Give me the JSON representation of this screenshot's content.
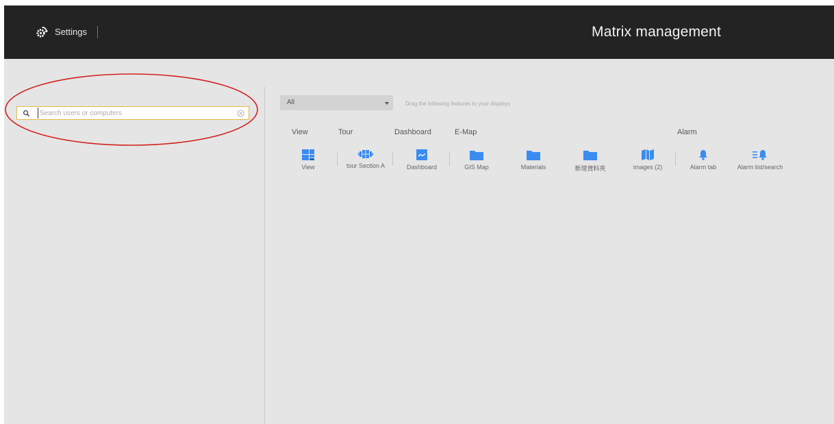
{
  "header": {
    "settings_label": "Settings",
    "page_title": "Matrix management",
    "settings_icon": "gear-icon"
  },
  "search": {
    "placeholder": "Search users or computers",
    "value": "",
    "icon": "search-icon",
    "clear_icon": "clear-icon"
  },
  "filter": {
    "selected": "All",
    "hint": "Drag the following features to your displays"
  },
  "groups": {
    "view": "View",
    "tour": "Tour",
    "dashboard": "Dashboard",
    "emap": "E-Map",
    "alarm": "Alarm"
  },
  "features": [
    {
      "label": "View",
      "icon": "view-layout-icon"
    },
    {
      "label": "tour Section A",
      "icon": "tour-icon"
    },
    {
      "label": "Dashboard",
      "icon": "dashboard-icon"
    },
    {
      "label": "GIS Map",
      "icon": "folder-icon"
    },
    {
      "label": "Materials",
      "icon": "folder-icon"
    },
    {
      "label": "新增資料夾",
      "icon": "folder-icon"
    },
    {
      "label": "images (2)",
      "icon": "map-icon"
    },
    {
      "label": "Alarm tab",
      "icon": "bell-icon"
    },
    {
      "label": "Alarm list/search",
      "icon": "alarm-list-icon"
    }
  ],
  "colors": {
    "accent": "#3a8cf0",
    "highlight": "#d32020",
    "topbar": "#232323"
  }
}
